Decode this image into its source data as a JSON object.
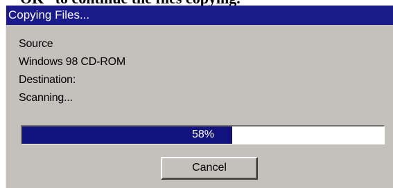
{
  "page": {
    "clipped_heading": "“OK” to continue the files copying."
  },
  "dialog": {
    "title": "Copying Files...",
    "source_label": "Source",
    "source_value": "Windows 98 CD-ROM",
    "destination_label": "Destination:",
    "status": "Scanning...",
    "progress_percent": 58,
    "progress_text": "58%",
    "cancel_label": "Cancel"
  },
  "colors": {
    "titlebar": "#1a1a8a",
    "progress_fill": "#12127e",
    "dialog_face": "#c4c1bd"
  }
}
